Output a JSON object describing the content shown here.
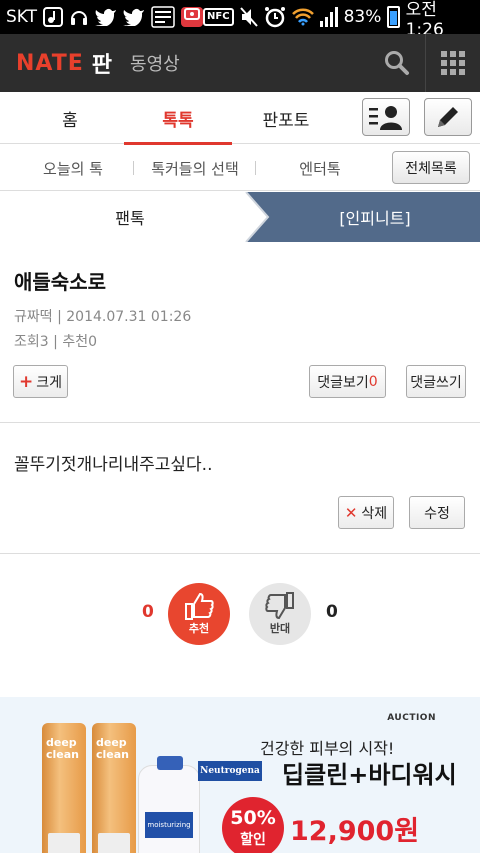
{
  "status_bar": {
    "carrier": "SKT",
    "battery_percent": "83%",
    "time": "오전 1:26",
    "nfc_label": "NFC",
    "left_icons": [
      "music-icon",
      "headset-icon",
      "twitter-icon",
      "twitter-icon",
      "memo-icon",
      "app-badge-icon"
    ],
    "right_icons": [
      "nfc-icon",
      "mute-icon",
      "alarm-icon",
      "wifi-icon",
      "signal-icon",
      "battery-icon"
    ]
  },
  "app_header": {
    "logo_nate": "NATE",
    "logo_pan": "판",
    "video_link": "동영상",
    "icons": [
      "search-icon",
      "grid-menu-icon"
    ]
  },
  "main_tabs": {
    "items": [
      {
        "label": "홈",
        "active": false
      },
      {
        "label": "톡톡",
        "active": true
      },
      {
        "label": "판포토",
        "active": false
      }
    ],
    "icon_buttons": [
      "profile-list-icon",
      "write-pencil-icon"
    ],
    "accent_color": "#e0382e"
  },
  "sub_tabs": {
    "items": [
      {
        "label": "오늘의 톡"
      },
      {
        "label": "톡커들의 선택"
      },
      {
        "label": "엔터톡"
      }
    ],
    "all_list_button": "전체목록"
  },
  "breadcrumb": {
    "left": "팬톡",
    "right": "[인피니트]",
    "right_bg": "#526a8a"
  },
  "post": {
    "title": "애들숙소로",
    "author": "규짜떡",
    "date": "2014.07.31 01:26",
    "views_label": "조회",
    "views": "3",
    "recommend_label": "추천",
    "recommend_count": "0",
    "enlarge_button": "크게",
    "view_comments_button": "댓글보기",
    "comment_count": "0",
    "write_comment_button": "댓글쓰기",
    "body": "꼴뚜기젓개나리내주고싶다..",
    "delete_button": "삭제",
    "edit_button": "수정"
  },
  "votes": {
    "up_count": "0",
    "up_label": "추천",
    "down_count": "0",
    "down_label": "반대",
    "up_color": "#e8462f",
    "down_color": "#e6e6e6"
  },
  "ad": {
    "source": "AUCTION",
    "tagline": "건강한 피부의 시작!",
    "brand": "Neutrogena",
    "product": "딥클린+바디워시",
    "discount": "50%",
    "discount_label": "할인",
    "price": "12,900원",
    "tube_text": "deep\nclean",
    "bottle_label": "moisturizing"
  }
}
